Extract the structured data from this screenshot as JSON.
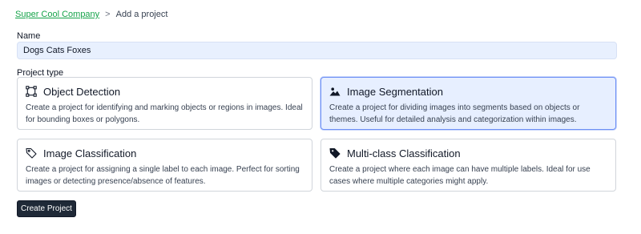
{
  "breadcrumb": {
    "parent": "Super Cool Company",
    "separator": ">",
    "current": "Add a project"
  },
  "form": {
    "name_label": "Name",
    "name_value": "Dogs Cats Foxes",
    "type_label": "Project type"
  },
  "project_types": [
    {
      "title": "Object Detection",
      "description": "Create a project for identifying and marking objects or regions in images. Ideal for bounding boxes or polygons.",
      "icon": "bounding-box-icon",
      "selected": false
    },
    {
      "title": "Image Segmentation",
      "description": "Create a project for dividing images into segments based on objects or themes. Useful for detailed analysis and categorization within images.",
      "icon": "image-icon",
      "selected": true
    },
    {
      "title": "Image Classification",
      "description": "Create a project for assigning a single label to each image. Perfect for sorting images or detecting presence/absence of features.",
      "icon": "tag-outline-icon",
      "selected": false
    },
    {
      "title": "Multi-class Classification",
      "description": "Create a project where each image can have multiple labels. Ideal for use cases where multiple categories might apply.",
      "icon": "tag-filled-icon",
      "selected": false
    }
  ],
  "actions": {
    "create_label": "Create Project"
  },
  "colors": {
    "link": "#16a34a",
    "selected_bg": "#e7efff",
    "selected_border": "#6d8ff5",
    "input_bg": "#e8f0fe",
    "button_bg": "#1f2937"
  }
}
